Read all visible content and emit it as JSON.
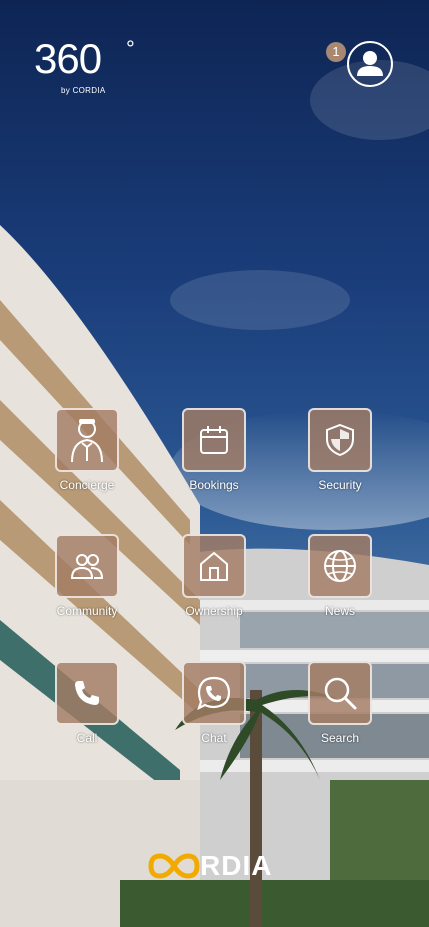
{
  "logo": {
    "number": "360",
    "degree": "°",
    "subtitle": "by CORDIA"
  },
  "header": {
    "notification_count": "1"
  },
  "tiles": [
    {
      "label": "Concierge",
      "icon": "concierge-icon"
    },
    {
      "label": "Bookings",
      "icon": "calendar-icon"
    },
    {
      "label": "Security",
      "icon": "shield-icon"
    },
    {
      "label": "Community",
      "icon": "people-icon"
    },
    {
      "label": "Ownership",
      "icon": "home-icon"
    },
    {
      "label": "News",
      "icon": "globe-icon"
    },
    {
      "label": "Call",
      "icon": "phone-icon"
    },
    {
      "label": "Chat",
      "icon": "whatsapp-icon"
    },
    {
      "label": "Search",
      "icon": "search-icon"
    }
  ],
  "brand": {
    "name": "RDIA",
    "accent_color": "#f2a900"
  },
  "colors": {
    "tile_fill": "#a47c64",
    "sky": "#1a3d7a",
    "badge": "#a98872"
  }
}
